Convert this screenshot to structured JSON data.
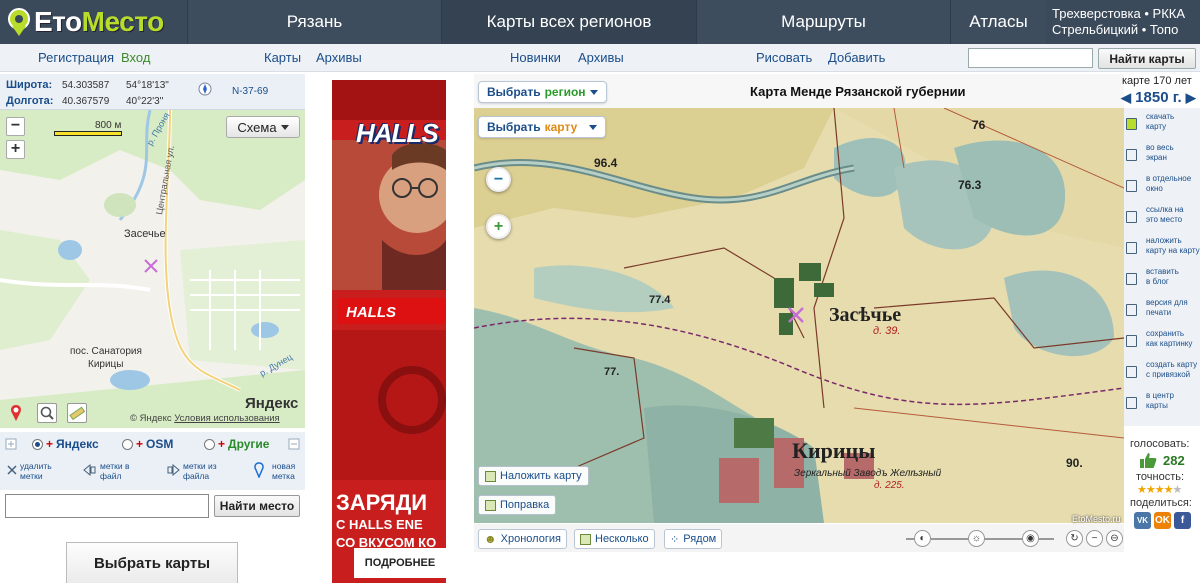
{
  "header": {
    "logo_prefix": "Ето",
    "logo_suffix": "Место",
    "nav": [
      "Рязань",
      "Карты всех регионов",
      "Маршруты",
      "Атласы"
    ],
    "links_line1": "Трехверстовка • РККА",
    "links_line2": "Стрельбицкий • Топо"
  },
  "subnav": {
    "register": "Регистрация",
    "login": "Вход",
    "maps": "Карты",
    "archives": "Архивы",
    "news": "Новинки",
    "archives2": "Архивы",
    "draw": "Рисовать",
    "add": "Добавить",
    "search_value": "",
    "search_button": "Найти карты"
  },
  "coords": {
    "lat_label": "Широта:",
    "lat_dec": "54.303587",
    "lat_dms": "54°18'13\"",
    "lon_label": "Долгота:",
    "lon_dec": "40.367579",
    "lon_dms": "40°22'3\"",
    "sheet": "N-37-69"
  },
  "small_map": {
    "scale": "800 м",
    "mode": "Схема",
    "labels": {
      "prona": "р. Проня",
      "central": "Центральная ул.",
      "zasechye": "Засечье",
      "sanatorium1": "пос. Санатория",
      "sanatorium2": "Кирицы",
      "dunets": "р. Дунец"
    },
    "copyright": "© Яндекс",
    "terms": "Условия использования",
    "brand": "Яндекс"
  },
  "providers": {
    "yandex": "Яндекс",
    "osm": "OSM",
    "other": "Другие",
    "selected": "Яндекс"
  },
  "tools": {
    "delete1": "удалить",
    "delete2": "метки",
    "tofile1": "метки в",
    "tofile2": "файл",
    "fromfile1": "метки из",
    "fromfile2": "файла",
    "new1": "новая",
    "new2": "метка"
  },
  "place_search": {
    "value": "",
    "button": "Найти место"
  },
  "choose_maps": "Выбрать карты",
  "ad": {
    "brand": "HALLS",
    "headline": "ЗАРЯДИ",
    "line1": "С HALLS ENE",
    "line2": "СО ВКУСОМ КО",
    "more": "ПОДРОБНЕЕ"
  },
  "main": {
    "select_region_a": "Выбрать",
    "select_region_b": "регион",
    "select_map_a": "Выбрать",
    "select_map_b": "карту",
    "title": "Карта Менде Рязанской губернии",
    "overlay": "Наложить карту",
    "correction": "Поправка",
    "chronology": "Хронология",
    "several": "Несколько",
    "side_by_side": "Рядом",
    "watermark": "EtoMesto.ru",
    "map_labels": {
      "zasechye": "Засѣчье",
      "d39": "д. 39.",
      "kiritsy": "Кирицы",
      "factory": "Зеркальный Заводъ Желѣзный",
      "d225": "д. 225.",
      "n76": "76",
      "n763": "76.3",
      "n964": "96.4",
      "n774": "77.4",
      "n77": "77.",
      "n90": "90."
    }
  },
  "side": {
    "age": "карте 170 лет",
    "year": "1850 г.",
    "tools": [
      {
        "l1": "скачать",
        "l2": "карту"
      },
      {
        "l1": "во весь",
        "l2": "экран"
      },
      {
        "l1": "в отдельное",
        "l2": "окно"
      },
      {
        "l1": "ссылка на",
        "l2": "это место"
      },
      {
        "l1": "наложить",
        "l2": "карту на карту"
      },
      {
        "l1": "вставить",
        "l2": "в блог"
      },
      {
        "l1": "версия для",
        "l2": "печати"
      },
      {
        "l1": "сохранить",
        "l2": "как картинку"
      },
      {
        "l1": "создать карту",
        "l2": "с привязкой"
      },
      {
        "l1": "в центр",
        "l2": "карты"
      }
    ],
    "vote_label": "голосовать:",
    "vote_count": "282",
    "accuracy_label": "точность:",
    "accuracy_stars": 4,
    "share_label": "поделиться:",
    "share": [
      "VK",
      "OK",
      "f"
    ]
  },
  "colors": {
    "header_bg": "#3b4a5a",
    "accent_green": "#b7dc2a",
    "link_blue": "#1a4d8a"
  }
}
